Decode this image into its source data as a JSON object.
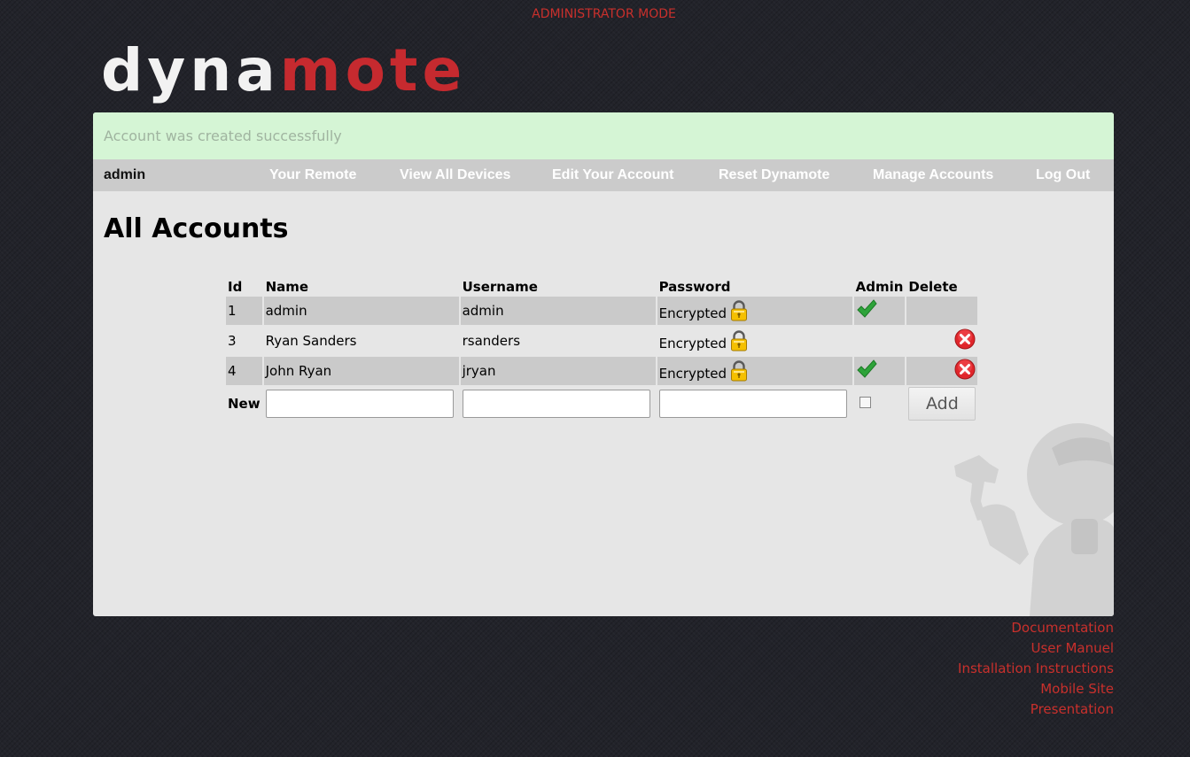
{
  "banner": {
    "mode": "ADMINISTRATOR MODE"
  },
  "logo": {
    "part1": "dyna",
    "part2": "mote"
  },
  "alert": {
    "message": "Account was created successfully"
  },
  "nav": {
    "user": "admin",
    "links": [
      "Your Remote",
      "View All Devices",
      "Edit Your Account",
      "Reset Dynamote",
      "Manage Accounts",
      "Log Out"
    ]
  },
  "page": {
    "title": "All Accounts"
  },
  "table": {
    "headers": {
      "id": "Id",
      "name": "Name",
      "username": "Username",
      "password": "Password",
      "admin": "Admin",
      "delete": "Delete"
    },
    "rows": [
      {
        "id": "1",
        "name": "admin",
        "username": "admin",
        "password": "Encrypted",
        "is_admin": true,
        "deletable": false
      },
      {
        "id": "3",
        "name": "Ryan Sanders",
        "username": "rsanders",
        "password": "Encrypted",
        "is_admin": false,
        "deletable": true
      },
      {
        "id": "4",
        "name": "John Ryan",
        "username": "jryan",
        "password": "Encrypted",
        "is_admin": true,
        "deletable": true
      }
    ],
    "new_row": {
      "label": "New",
      "name_value": "",
      "username_value": "",
      "password_value": "",
      "admin_checked": false,
      "add_label": "Add"
    }
  },
  "footer": {
    "links": [
      "Documentation",
      "User Manuel",
      "Installation Instructions",
      "Mobile Site",
      "Presentation"
    ]
  },
  "colors": {
    "accent_red": "#c9302c",
    "panel_bg": "#e6e6e6",
    "alert_bg": "#d5f5d5",
    "nav_bg": "#cbcbcb",
    "body_bg": "#22232a"
  },
  "icons": {
    "lock": "lock-icon",
    "check": "checkmark-icon",
    "delete": "delete-icon"
  }
}
